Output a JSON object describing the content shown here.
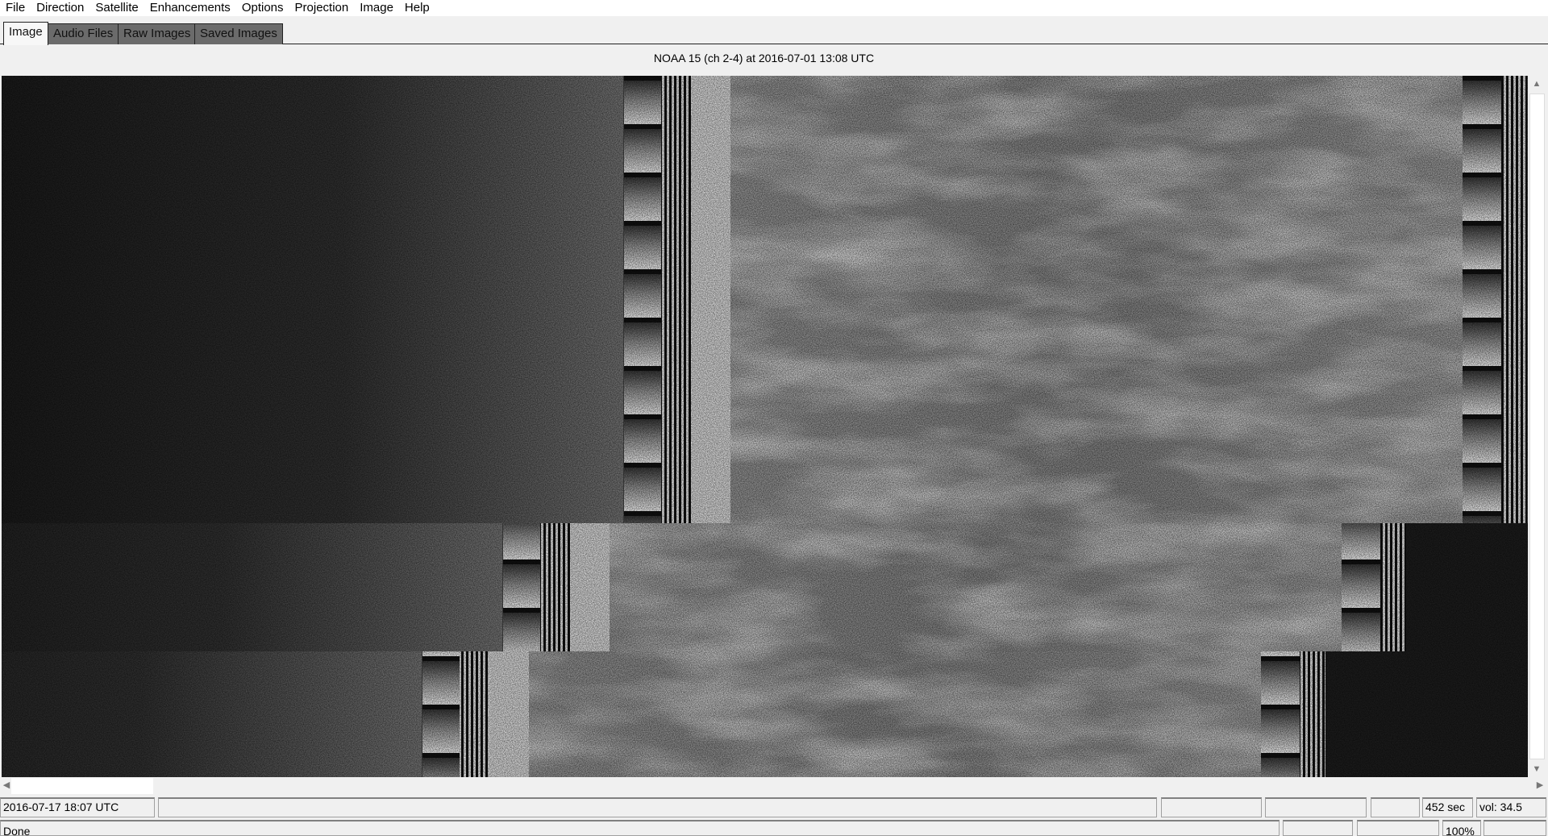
{
  "menu": [
    "File",
    "Direction",
    "Satellite",
    "Enhancements",
    "Options",
    "Projection",
    "Image",
    "Help"
  ],
  "tabs": [
    "Image",
    "Audio Files",
    "Raw Images",
    "Saved Images"
  ],
  "image_title": "NOAA 15 (ch 2-4) at 2016-07-01  13:08 UTC",
  "status": {
    "datetime": "2016-07-17  18:07 UTC",
    "duration": "452 sec",
    "volume": "vol: 34.5",
    "message": "Done",
    "zoom": "100%"
  },
  "colors": {
    "tab_inactive": "#6b6b6b",
    "background": "#f0f0f0"
  }
}
